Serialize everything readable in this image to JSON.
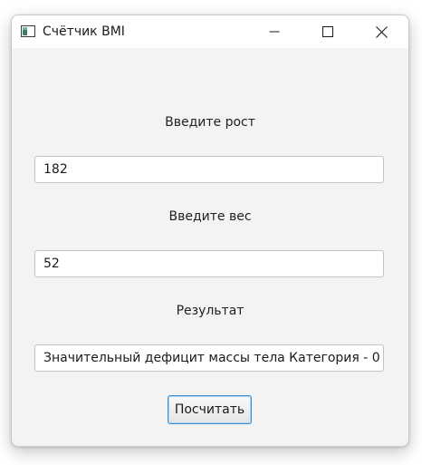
{
  "window": {
    "title": "Счётчик BMI"
  },
  "form": {
    "height_label": "Введите рост",
    "height_value": "182",
    "weight_label": "Введите вес",
    "weight_value": "52",
    "result_label": "Результат",
    "result_value": "Значительный дефицит массы тела  Категория - 0",
    "calculate_label": "Посчитать"
  },
  "icons": {
    "app": "app-window-icon",
    "minimize": "minimize-icon",
    "maximize": "maximize-icon",
    "close": "close-icon"
  },
  "colors": {
    "window_bg": "#f3f3f3",
    "titlebar_bg": "#ffffff",
    "button_focus_border": "#3d8fd6"
  }
}
